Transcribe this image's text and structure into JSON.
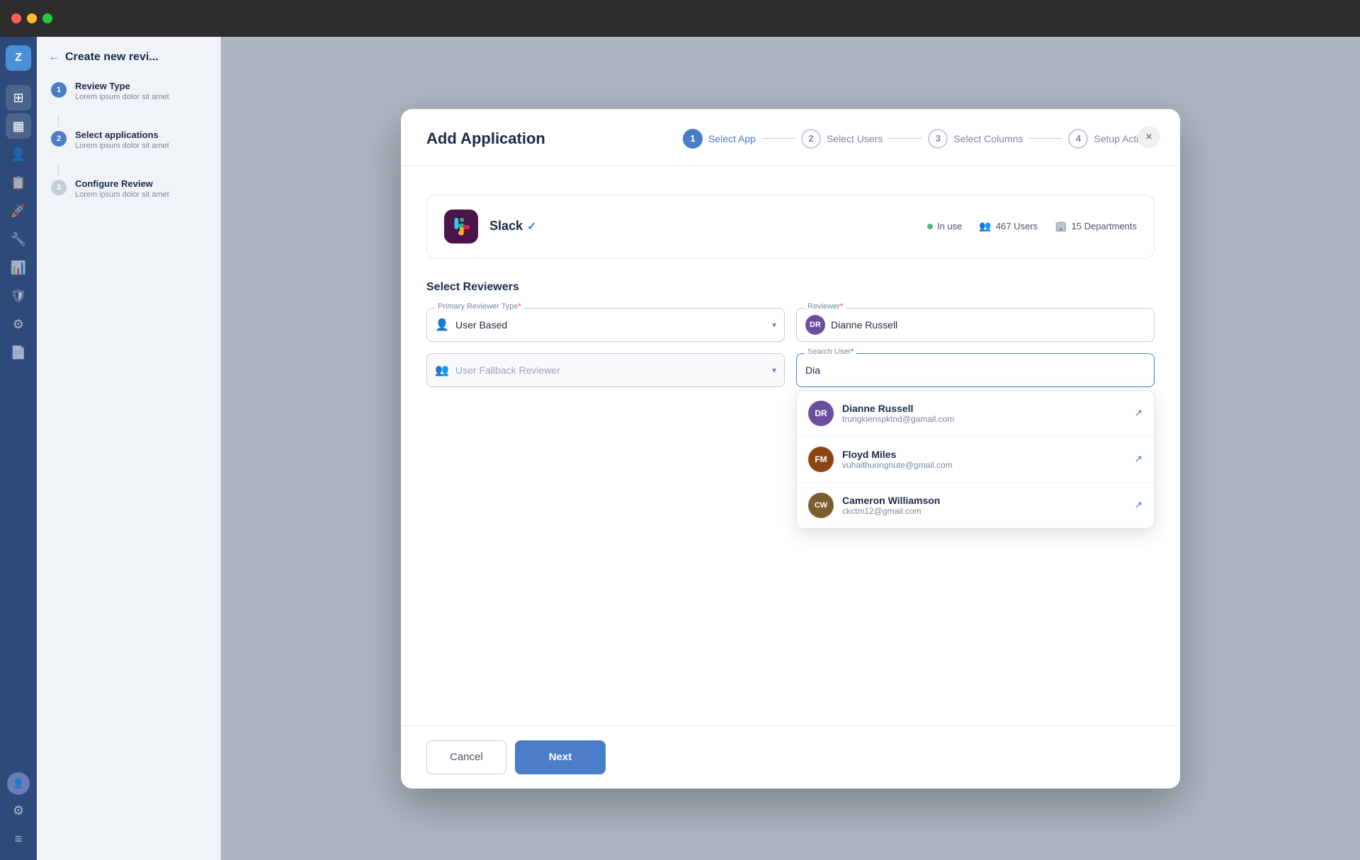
{
  "titlebar": {
    "traffic_lights": [
      "red",
      "yellow",
      "green"
    ]
  },
  "sidebar": {
    "logo": "Z",
    "items": [
      {
        "icon": "⊞",
        "active": false,
        "label": "dashboard-icon"
      },
      {
        "icon": "▦",
        "active": true,
        "label": "grid-icon"
      },
      {
        "icon": "👤",
        "active": false,
        "label": "user-icon"
      },
      {
        "icon": "📋",
        "active": false,
        "label": "document-icon"
      },
      {
        "icon": "🚀",
        "active": false,
        "label": "rocket-icon"
      },
      {
        "icon": "🔧",
        "active": false,
        "label": "tools-icon"
      },
      {
        "icon": "📊",
        "active": false,
        "label": "chart-icon"
      },
      {
        "icon": "🛡",
        "active": false,
        "label": "shield-icon"
      },
      {
        "icon": "⚙",
        "active": false,
        "label": "gear-icon"
      },
      {
        "icon": "📄",
        "active": false,
        "label": "clipboard-icon"
      }
    ],
    "bottom_items": [
      {
        "icon": "👤",
        "label": "user-avatar-icon"
      },
      {
        "icon": "⚙",
        "label": "settings-icon"
      },
      {
        "icon": "≡",
        "label": "menu-icon"
      }
    ]
  },
  "left_panel": {
    "back_arrow": "←",
    "title": "Create new revi...",
    "steps": [
      {
        "number": "1",
        "title": "Review Type",
        "desc": "Lorem ipsum dolor sit amet",
        "active": true
      },
      {
        "number": "2",
        "title": "Select applications",
        "desc": "Lorem ipsum dolor sit amet",
        "active": true
      },
      {
        "number": "3",
        "title": "Configure Review",
        "desc": "Lorem ipsum dolor sit amet",
        "active": false
      }
    ]
  },
  "modal": {
    "title": "Add Application",
    "close_label": "×",
    "wizard": {
      "steps": [
        {
          "number": "1",
          "label": "Select App",
          "active": true
        },
        {
          "number": "2",
          "label": "Select Users",
          "active": false
        },
        {
          "number": "3",
          "label": "Select Columns",
          "active": false
        },
        {
          "number": "4",
          "label": "Setup Actions",
          "active": false
        }
      ]
    },
    "app_card": {
      "name": "Slack",
      "verified": "✓",
      "in_use_label": "In use",
      "users_count": "467 Users",
      "departments_count": "15 Departments"
    },
    "reviewers_section": {
      "title": "Select Reviewers",
      "primary_reviewer_type_label": "Primary Reviewer Type",
      "primary_reviewer_type_value": "User Based",
      "reviewer_label": "Reviewer",
      "reviewer_value": "Dianne Russell",
      "fallback_label": "User Fallback Reviewer",
      "search_label": "Search User",
      "search_value": "Dia"
    },
    "dropdown_users": [
      {
        "name": "Dianne Russell",
        "email": "trungkienspktnd@gamail.com",
        "initials": "DR"
      },
      {
        "name": "Floyd Miles",
        "email": "vuhaithuongnute@gmail.com",
        "initials": "FM"
      },
      {
        "name": "Cameron Williamson",
        "email": "ckctm12@gmail.com",
        "initials": "CW"
      }
    ],
    "footer": {
      "cancel_label": "Cancel",
      "next_label": "Next"
    }
  }
}
